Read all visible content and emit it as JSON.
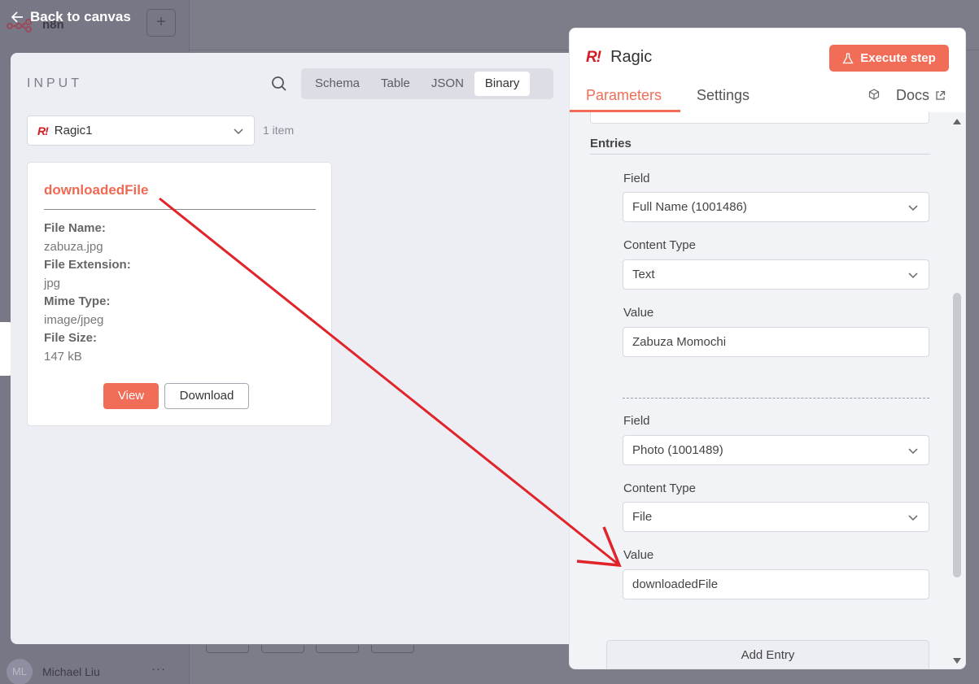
{
  "background": {
    "app_name": "n8n",
    "user_initials": "ML",
    "user_name": "Michael Liu",
    "dots": "···",
    "add": "+"
  },
  "back_link": {
    "label": "Back to canvas",
    "icon": "arrow-left-icon"
  },
  "input_panel": {
    "title": "INPUT",
    "view_tabs": [
      "Schema",
      "Table",
      "JSON",
      "Binary"
    ],
    "active_tab": "Binary",
    "node_select": {
      "value": "Ragic1",
      "logo": "R!"
    },
    "items_count": "1 item",
    "binary_card": {
      "key": "downloadedFile",
      "meta": [
        {
          "label": "File Name:",
          "value": "zabuza.jpg"
        },
        {
          "label": "File Extension:",
          "value": "jpg"
        },
        {
          "label": "Mime Type:",
          "value": "image/jpeg"
        },
        {
          "label": "File Size:",
          "value": "147 kB"
        }
      ],
      "view_label": "View",
      "download_label": "Download"
    }
  },
  "params_panel": {
    "logo": "R!",
    "node_title": "Ragic",
    "execute_label": "Execute step",
    "tabs": {
      "parameters": "Parameters",
      "settings": "Settings"
    },
    "docs_label": "Docs",
    "entries_label": "Entries",
    "entries": [
      {
        "field_label": "Field",
        "field_value": "Full Name (1001486)",
        "content_type_label": "Content Type",
        "content_type_value": "Text",
        "value_label": "Value",
        "value": "Zabuza Momochi"
      },
      {
        "field_label": "Field",
        "field_value": "Photo (1001489)",
        "content_type_label": "Content Type",
        "content_type_value": "File",
        "value_label": "Value",
        "value": "downloadedFile"
      }
    ],
    "add_entry_label": "Add Entry"
  },
  "colors": {
    "accent": "#f26d57",
    "ragic_red": "#d21d24",
    "annotation_arrow": "#e0242a"
  }
}
